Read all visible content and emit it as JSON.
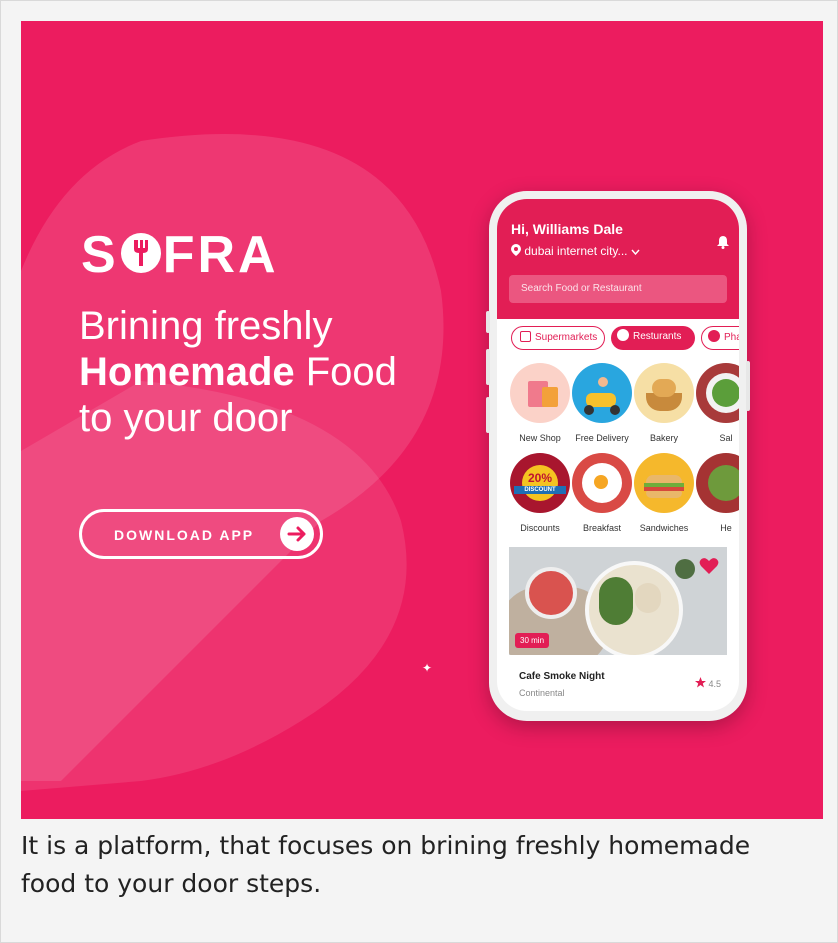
{
  "brand": {
    "name_left": "S",
    "name_right": "FRA"
  },
  "headline": {
    "line1": "Brining freshly",
    "line2_bold": "Homemade",
    "line2_rest": " Food",
    "line3": "to your door"
  },
  "download_button": {
    "label": "DOWNLOAD APP"
  },
  "phone": {
    "greeting": "Hi, Williams Dale",
    "location": "dubai internet city...",
    "search_placeholder": "Search Food or Restaurant",
    "chips": [
      {
        "label": "Supermarkets"
      },
      {
        "label": "Resturants"
      },
      {
        "label": "Pha"
      }
    ],
    "categories": [
      {
        "label": "New Shop"
      },
      {
        "label": "Free Delivery"
      },
      {
        "label": "Bakery"
      },
      {
        "label": "Sal"
      },
      {
        "label": "Discounts"
      },
      {
        "label": "Breakfast"
      },
      {
        "label": "Sandwiches"
      },
      {
        "label": "He"
      }
    ],
    "discount_text": "20%",
    "discount_word": "DISCOUNT",
    "card": {
      "time": "30 min",
      "title": "Cafe Smoke Night",
      "subtitle": "Continental",
      "rating": "4.5"
    }
  },
  "caption": "It is a platform, that focuses on brining freshly homemade food to your door steps.",
  "colors": {
    "brand": "#ec1c5f",
    "accent": "#e21e55"
  },
  "icons": [
    "fork-logo-icon",
    "arrow-right-icon",
    "location-pin-icon",
    "chevron-down-icon",
    "bell-icon",
    "store-icon",
    "dish-icon",
    "plus-icon",
    "heart-icon",
    "star-icon"
  ]
}
